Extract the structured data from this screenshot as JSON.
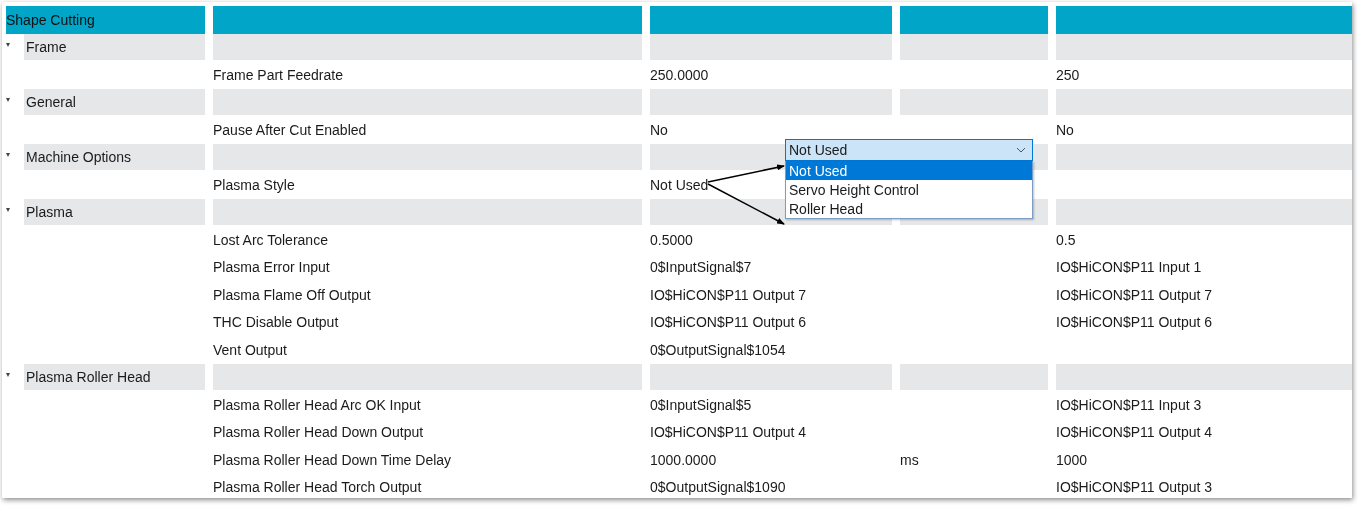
{
  "header": {
    "title": "Shape Cutting"
  },
  "groups": [
    {
      "label": "Frame",
      "expanded": true,
      "settings": [
        {
          "name": "Frame Part Feedrate",
          "value": "250.0000",
          "default": "250"
        }
      ]
    },
    {
      "label": "General",
      "expanded": true,
      "settings": [
        {
          "name": "Pause After Cut Enabled",
          "value": "No",
          "default": "No"
        }
      ]
    },
    {
      "label": "Machine Options",
      "expanded": true,
      "settings": [
        {
          "name": "Plasma Style",
          "value": "Not Used"
        }
      ]
    },
    {
      "label": "Plasma",
      "expanded": true,
      "settings": [
        {
          "name": "Lost Arc Tolerance",
          "value": "0.5000",
          "default": "0.5"
        },
        {
          "name": "Plasma Error Input",
          "value": "0$InputSignal$7",
          "default": "IO$HiCON$P11 Input 1"
        },
        {
          "name": "Plasma Flame Off Output",
          "value": "IO$HiCON$P11 Output 7",
          "default": "IO$HiCON$P11 Output 7"
        },
        {
          "name": "THC Disable Output",
          "value": "IO$HiCON$P11 Output 6",
          "default": "IO$HiCON$P11 Output 6"
        },
        {
          "name": "Vent Output",
          "value": "0$OutputSignal$1054"
        }
      ]
    },
    {
      "label": "Plasma Roller Head",
      "expanded": true,
      "settings": [
        {
          "name": "Plasma Roller Head Arc OK Input",
          "value": "0$InputSignal$5",
          "default": "IO$HiCON$P11 Input 3"
        },
        {
          "name": "Plasma Roller Head Down Output",
          "value": "IO$HiCON$P11 Output 4",
          "default": "IO$HiCON$P11 Output 4"
        },
        {
          "name": "Plasma Roller Head Down Time Delay",
          "value": "1000.0000",
          "unit": "ms",
          "default": "1000"
        },
        {
          "name": "Plasma Roller Head Torch Output",
          "value": "0$OutputSignal$1090",
          "default": "IO$HiCON$P11 Output 3"
        }
      ]
    }
  ],
  "dropdown": {
    "value": "Not Used",
    "open": true,
    "options": [
      {
        "label": "Not Used",
        "selected": true
      },
      {
        "label": "Servo Height Control",
        "selected": false
      },
      {
        "label": "Roller Head",
        "selected": false
      }
    ]
  }
}
